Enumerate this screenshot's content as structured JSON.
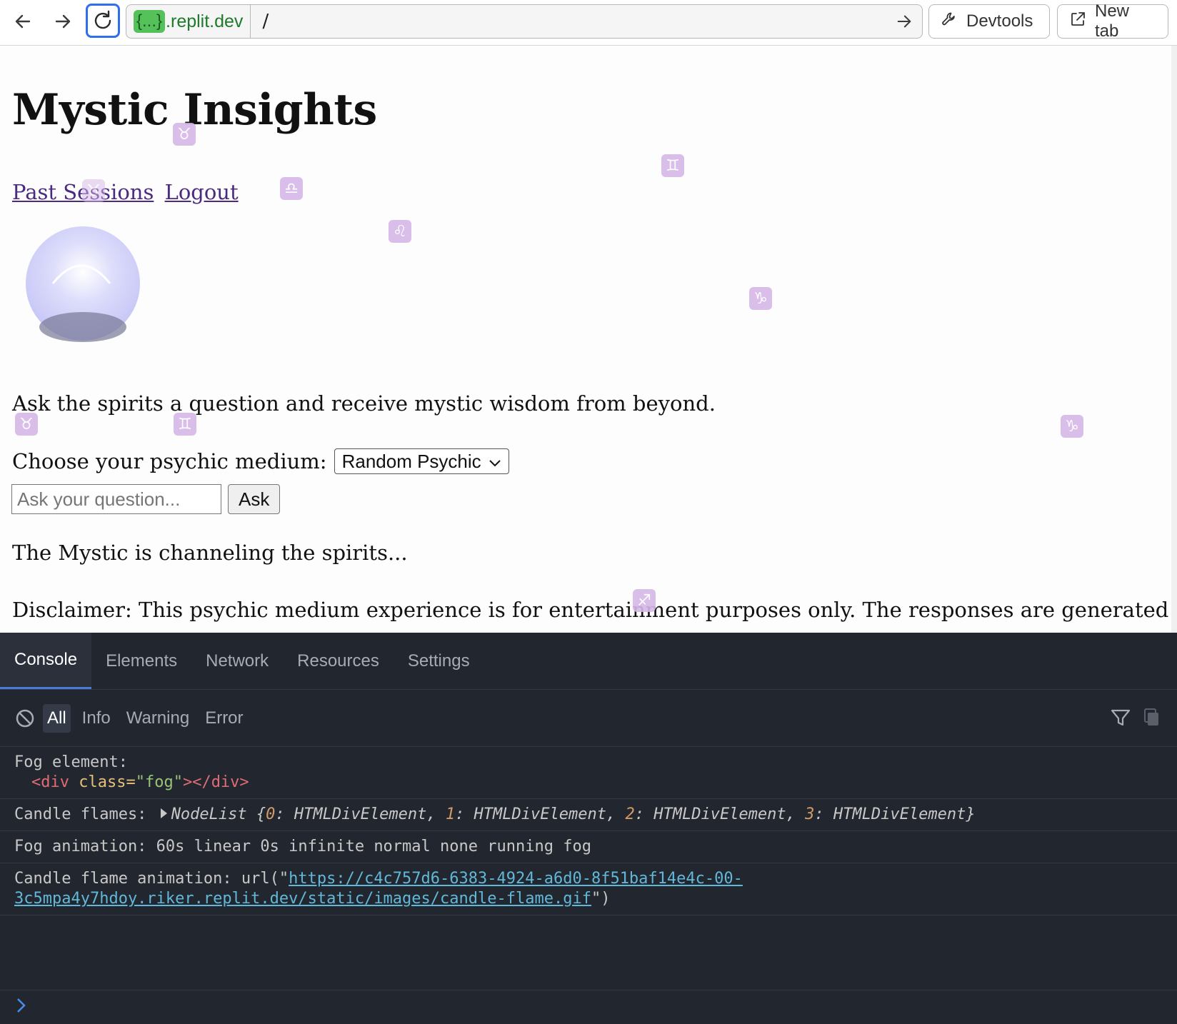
{
  "browser": {
    "url_host_badge": "{...}",
    "url_host": ".replit.dev",
    "url_path": "/",
    "devtools_label": "Devtools",
    "newtab_label": "New tab"
  },
  "page": {
    "title": "Mystic Insights",
    "nav": {
      "past_sessions": "Past Sessions",
      "logout": "Logout"
    },
    "intro": "Ask the spirits a question and receive mystic wisdom from beyond.",
    "medium_label": "Choose your psychic medium:",
    "medium_selected": "Random Psychic",
    "question_placeholder": "Ask your question...",
    "ask_label": "Ask",
    "status": "The Mystic is channeling the spirits...",
    "disclaimer": "Disclaimer: This psychic medium experience is for entertainment purposes only. The responses are generated by",
    "zodiac_symbols": [
      "♉",
      "♊",
      "♎",
      "♌",
      "♑",
      "♉",
      "♊",
      "♑",
      "♐",
      "♉"
    ]
  },
  "devtools": {
    "tabs": [
      "Console",
      "Elements",
      "Network",
      "Resources",
      "Settings"
    ],
    "filters": [
      "All",
      "Info",
      "Warning",
      "Error"
    ],
    "logs": {
      "fog_label": "Fog element:",
      "fog_tag_open": "<div",
      "fog_attr": "class=",
      "fog_attr_value": "\"fog\"",
      "fog_tag_close": "></div>",
      "candle_label": "Candle flames:",
      "candle_type": "NodeList {",
      "candle_items": [
        {
          "index": "0",
          "value": ": HTMLDivElement, "
        },
        {
          "index": "1",
          "value": ": HTMLDivElement, "
        },
        {
          "index": "2",
          "value": ": HTMLDivElement, "
        },
        {
          "index": "3",
          "value": ": HTMLDivElement}"
        }
      ],
      "fog_animation": "Fog animation: 60s linear 0s infinite normal none running fog",
      "candle_anim_label": "Candle flame animation: url(\"",
      "candle_anim_url_1": "https://c4c757d6-6383-4924-a6d0-8f51baf14e4c-00-",
      "candle_anim_url_2": "3c5mpa4y7hdoy.riker.replit.dev/static/images/candle-flame.gif",
      "candle_anim_end": "\")"
    }
  }
}
